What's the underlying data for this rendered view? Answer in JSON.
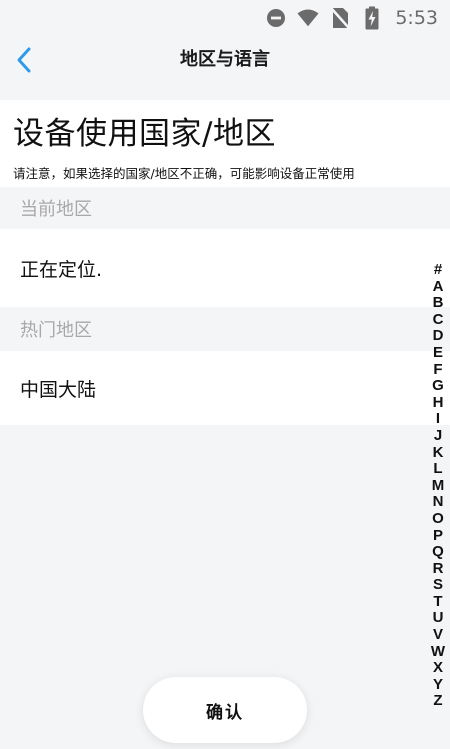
{
  "status_bar": {
    "time": "5:53",
    "icons": [
      "do-not-disturb-icon",
      "wifi-icon",
      "no-sim-icon",
      "battery-charging-icon"
    ]
  },
  "nav": {
    "back_icon": "chevron-left-icon",
    "title": "地区与语言"
  },
  "heading": {
    "title": "设备使用国家/地区",
    "notice": "请注意，如果选择的国家/地区不正确，可能影响设备正常使用"
  },
  "sections": {
    "current_header": "当前地区",
    "current_value": "正在定位.",
    "hot_header": "热门地区",
    "hot_items": [
      "中国大陆"
    ]
  },
  "alphabet_index": [
    "#",
    "A",
    "B",
    "C",
    "D",
    "E",
    "F",
    "G",
    "H",
    "I",
    "J",
    "K",
    "L",
    "M",
    "N",
    "O",
    "P",
    "Q",
    "R",
    "S",
    "T",
    "U",
    "V",
    "W",
    "X",
    "Y",
    "Z"
  ],
  "confirm_button": {
    "label": "确认"
  },
  "colors": {
    "accent": "#2f9be8",
    "background": "#f4f5f7",
    "section_header_text": "#a8a8a8",
    "status_icon": "#6b6b6b"
  }
}
